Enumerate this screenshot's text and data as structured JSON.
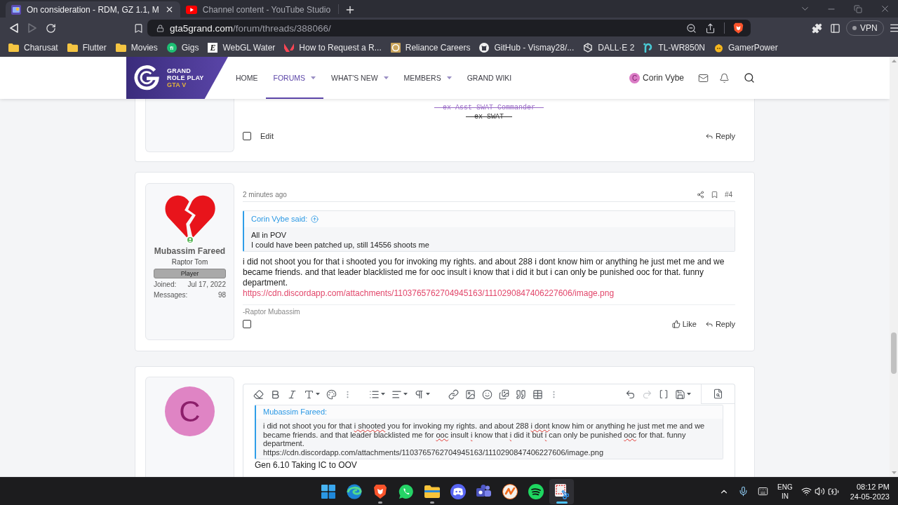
{
  "browser": {
    "tabs": [
      {
        "title": "On consideration - RDM, GZ 1.1, M",
        "kind": "forum",
        "selected": true
      },
      {
        "title": "Channel content - YouTube Studio",
        "kind": "video",
        "selected": false
      }
    ],
    "navigation": {
      "forward_disabled": true
    },
    "address": {
      "host": "gta5grand.com",
      "path": "/forum/threads/388066/"
    },
    "vpn": {
      "label": "VPN",
      "connected": false
    },
    "bookmarks": [
      {
        "label": "Charusat",
        "kind": "folder"
      },
      {
        "label": "Flutter",
        "kind": "folder"
      },
      {
        "label": "Movies",
        "kind": "folder"
      },
      {
        "label": "Gigs",
        "kind": "badge",
        "glyph": "fi"
      },
      {
        "label": "WebGL Water",
        "kind": "letter",
        "glyph": "E"
      },
      {
        "label": "How to Request a R...",
        "kind": "chevron"
      },
      {
        "label": "Reliance Careers",
        "kind": "tile"
      },
      {
        "label": "GitHub - Vismay28/...",
        "kind": "cat"
      },
      {
        "label": "DALL·E 2",
        "kind": "knot"
      },
      {
        "label": "TL-WR850N",
        "kind": "hook"
      },
      {
        "label": "GamerPower",
        "kind": "coin"
      }
    ]
  },
  "forum": {
    "logo": {
      "title": "GRAND",
      "subtitle": "ROLE PLAY",
      "tag": "GTA V"
    },
    "nav": [
      {
        "label": "HOME",
        "selected": false,
        "dropdown": false
      },
      {
        "label": "FORUMS",
        "selected": true,
        "dropdown": true
      },
      {
        "label": "WHAT'S NEW",
        "selected": false,
        "dropdown": true
      },
      {
        "label": "MEMBERS",
        "selected": false,
        "dropdown": true
      },
      {
        "label": "GRAND WIKI",
        "selected": false,
        "dropdown": false
      }
    ],
    "user": {
      "initial": "C",
      "name": "Corin Vybe"
    }
  },
  "previous_post": {
    "signature": [
      {
        "text": "--ex Asst SWAT Commander--",
        "color": "#9a6cc6",
        "struck": true
      },
      {
        "text": "--ex SWAT--",
        "color": "#333333",
        "struck": true
      }
    ],
    "checked": false,
    "edit": "Edit",
    "reply": "Reply"
  },
  "post": {
    "author": {
      "name": "Mubassim Fareed",
      "title": "Raptor Tom",
      "badge": "Player",
      "online": true,
      "stats": [
        {
          "label": "Joined:",
          "value": "Jul 17, 2022"
        },
        {
          "label": "Messages:",
          "value": "98"
        }
      ]
    },
    "time": "2 minutes ago",
    "number": "#4",
    "quote": {
      "author": "Corin Vybe said:",
      "lines": [
        "All in POV",
        "I could have been patched up, still 14556 shoots me"
      ]
    },
    "body": "i did not shoot you for that i shooted you for invoking my rights. and about 288 i dont know him or anything he just met me and we became friends. and that leader blacklisted me for ooc insult i know that i did it but i can only be punished ooc for that. funny department.",
    "link": "https://cdn.discordapp.com/attachments/1103765762704945163/1110290847406227606/image.png",
    "signature": "-Raptor Mubassim",
    "checked": false,
    "actions": [
      {
        "label": "Like",
        "kind": "like"
      },
      {
        "label": "Reply",
        "kind": "reply"
      }
    ]
  },
  "reply_box": {
    "avatar_initial": "C",
    "redo_disabled": true,
    "quote": {
      "author": "Mubassim Fareed:",
      "segments": [
        {
          "text": "i did not shoot you for that ",
          "misspelled": false
        },
        {
          "text": "i shooted",
          "misspelled": true
        },
        {
          "text": " you for invoking my rights. and about 288 ",
          "misspelled": false
        },
        {
          "text": "i dont",
          "misspelled": true
        },
        {
          "text": " know him or anything he just met me and we became friends. and that leader blacklisted me for ",
          "misspelled": false
        },
        {
          "text": "ooc",
          "misspelled": true
        },
        {
          "text": " insult ",
          "misspelled": false
        },
        {
          "text": "i",
          "misspelled": true
        },
        {
          "text": " know that ",
          "misspelled": false
        },
        {
          "text": "i",
          "misspelled": true
        },
        {
          "text": " did it but ",
          "misspelled": false
        },
        {
          "text": "i",
          "misspelled": true
        },
        {
          "text": " can only be punished ",
          "misspelled": false
        },
        {
          "text": "ooc",
          "misspelled": true
        },
        {
          "text": " for that. funny department.",
          "misspelled": false
        }
      ],
      "link": "https://cdn.discordapp.com/attachments/1103765762704945163/1110290847406227606/image.png"
    },
    "value": "Gen 6.10 Taking IC to OOV"
  },
  "taskbar": {
    "apps": [
      {
        "kind": "start",
        "running": false,
        "active": false
      },
      {
        "kind": "wave",
        "running": false,
        "active": false
      },
      {
        "kind": "shield",
        "running": true,
        "active": false
      },
      {
        "kind": "chat",
        "running": false,
        "active": false
      },
      {
        "kind": "files",
        "running": true,
        "active": false
      },
      {
        "kind": "gamepad",
        "running": false,
        "active": false
      },
      {
        "kind": "team",
        "running": false,
        "active": false
      },
      {
        "kind": "zigzag",
        "running": false,
        "active": false
      },
      {
        "kind": "music",
        "running": false,
        "active": false
      },
      {
        "kind": "snip",
        "running": true,
        "active": true
      }
    ],
    "language": [
      "ENG",
      "IN"
    ],
    "clock": {
      "time": "08:12 PM",
      "date": "24-05-2023"
    }
  }
}
